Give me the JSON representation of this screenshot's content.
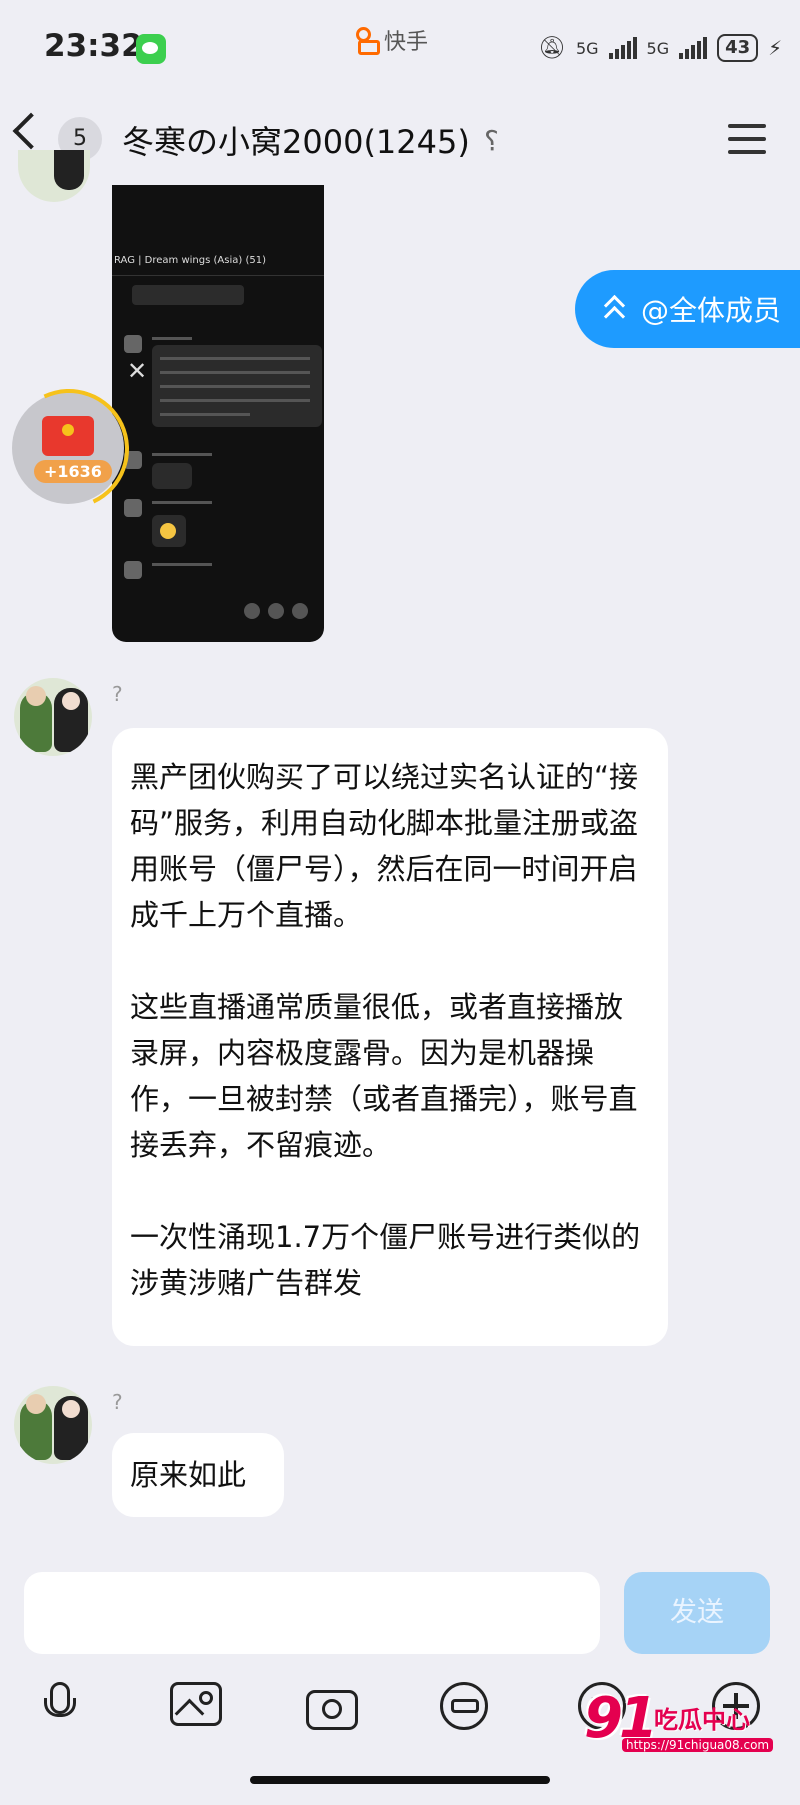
{
  "status_bar": {
    "time": "23:32",
    "app_name": "快手",
    "network_1": "5G",
    "network_2": "5G",
    "battery": "43"
  },
  "header": {
    "unread_count": "5",
    "title": "冬寒の小窝2000(1245)",
    "icons": [
      "back-arrow-icon",
      "ear-icon",
      "menu-icon"
    ]
  },
  "screenshot_message": {
    "group_label": "RAG | Dream wings (Asia) (51)"
  },
  "red_packet": {
    "count": "+1636",
    "color": "#e8382d"
  },
  "mention_chip": {
    "label": "@全体成员",
    "color": "#1e9bff"
  },
  "messages": [
    {
      "sender_name": "?",
      "paragraphs": [
        "黑产团伙购买了可以绕过实名认证的“接码”服务，利用自动化脚本批量注册或盗用账号（僵尸号），然后在同一时间开启成千上万个直播。",
        "这些直播通常质量很低，或者直接播放录屏，内容极度露骨。因为是机器操作，一旦被封禁（或者直播完），账号直接丢弃，不留痕迹。",
        "一次性涌现1.7万个僵尸账号进行类似的涉黄涉赌广告群发"
      ]
    },
    {
      "sender_name": "?",
      "text": "原来如此"
    }
  ],
  "input_bar": {
    "send_label": "发送",
    "send_color": "#a6d3f6"
  },
  "toolbar": {
    "icons": [
      "microphone-icon",
      "image-icon",
      "camera-icon",
      "sticker-icon",
      "emoji-icon",
      "plus-icon"
    ]
  },
  "watermark": {
    "number": "91",
    "name": "吃瓜中心",
    "url": "https://91chigua08.com"
  }
}
